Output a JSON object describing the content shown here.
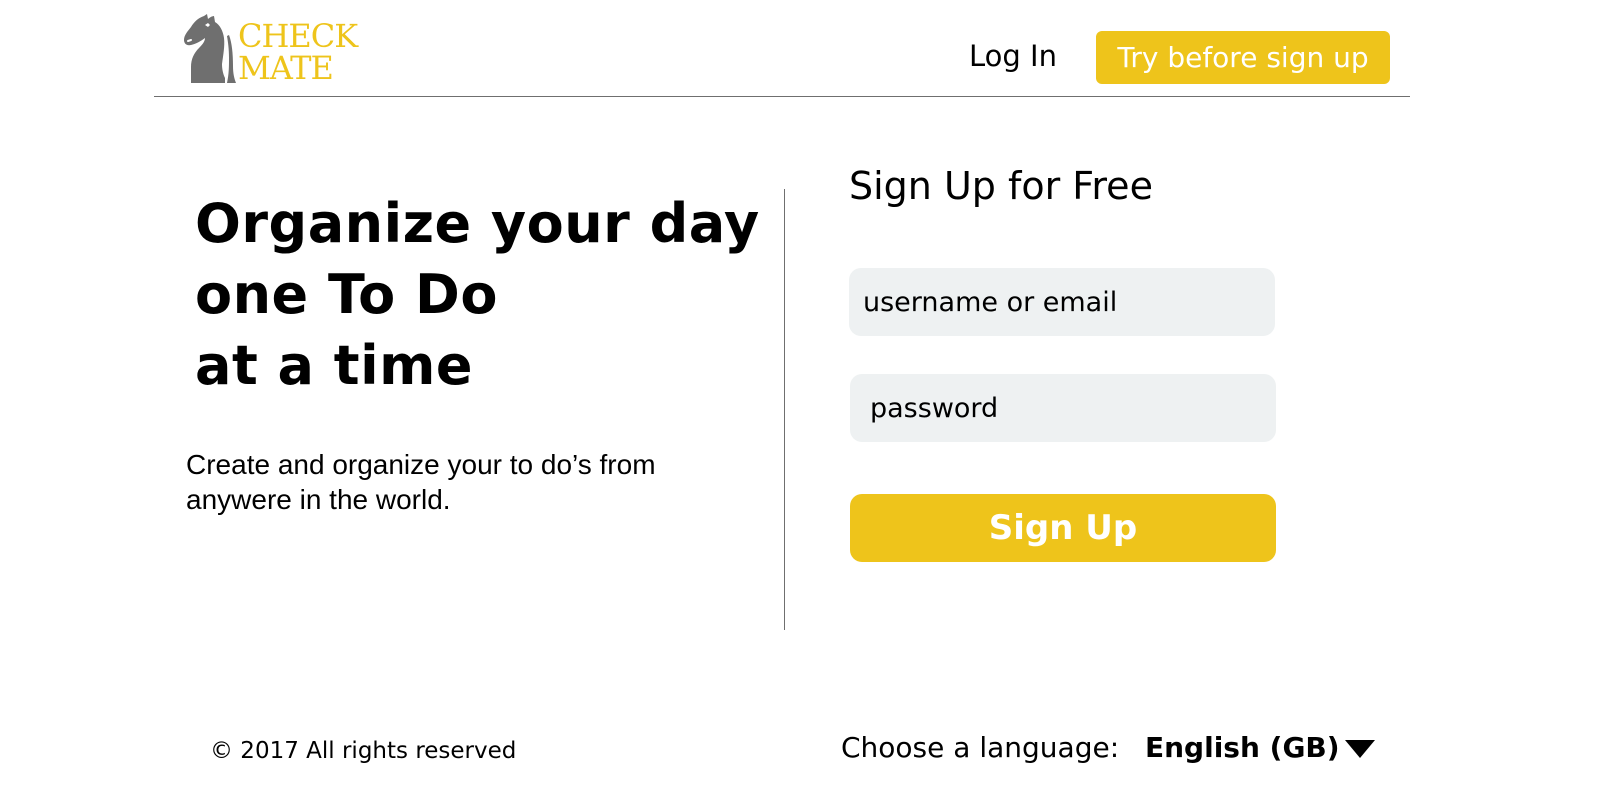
{
  "header": {
    "logo": {
      "icon": "chess-knight-icon",
      "line1": "CHECK",
      "line2": "MATE"
    },
    "login_label": "Log In",
    "try_label": "Try before sign up"
  },
  "hero": {
    "heading_lines": [
      "Organize your day",
      "one To Do",
      "at a time"
    ],
    "subtext": "Create and organize your to do’s from anywere in the world."
  },
  "signup": {
    "title": "Sign Up for Free",
    "email_placeholder": "username or email",
    "email_value": "",
    "password_placeholder": "password",
    "password_value": "",
    "submit_label": "Sign Up"
  },
  "footer": {
    "copyright": "© 2017 All rights reserved",
    "language_label": "Choose a language:",
    "language_value": "English (GB)",
    "language_icon": "chevron-down-icon"
  },
  "colors": {
    "brand_yellow": "#eec41b",
    "logo_gray": "#6f6f6f",
    "input_background": "#eef1f2",
    "button_text": "#ffffff",
    "divider": "#6f6f6f"
  }
}
